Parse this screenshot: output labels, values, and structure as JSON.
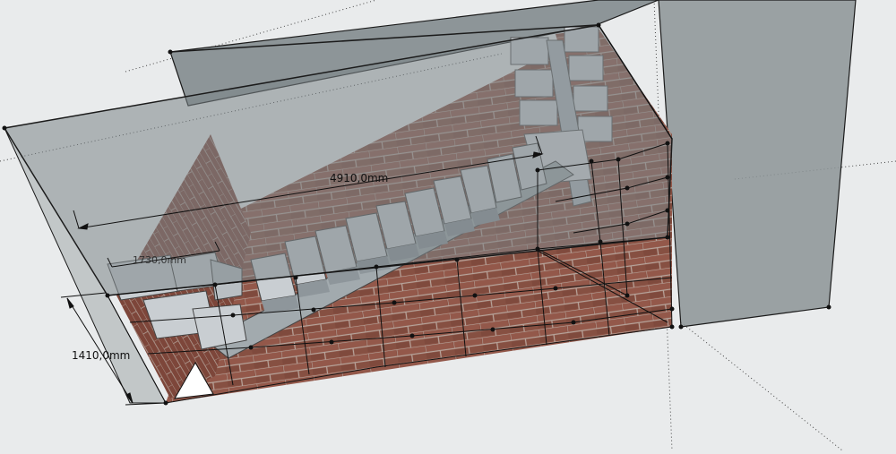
{
  "dimensions": {
    "length_label": "4910,0mm",
    "height_label": "1410,0mm",
    "small_label": "1730,0mm"
  },
  "colors": {
    "background": "#e9ebec",
    "glass": "#7c8588",
    "brick": "#8c5244",
    "mortar": "#b7a59c",
    "stair": "#c9ced2",
    "stair_shadow": "#8e969b",
    "outline": "#1b1b1b"
  },
  "icons": {
    "marker": "triangle-marker-icon"
  }
}
